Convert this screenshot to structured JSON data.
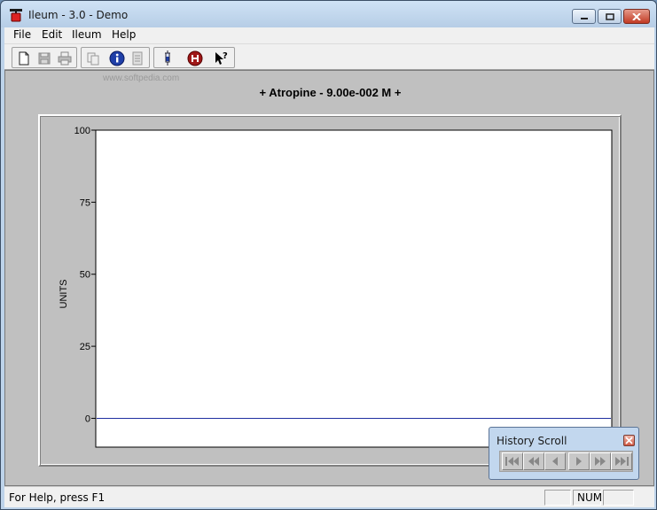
{
  "window": {
    "title": "Ileum - 3.0 - Demo",
    "icon": "ileum-app-icon",
    "controls": [
      "minimize",
      "maximize",
      "close"
    ]
  },
  "menu": [
    "File",
    "Edit",
    "Ileum",
    "Help"
  ],
  "toolbar": {
    "buttons": [
      {
        "name": "new-document-icon",
        "enabled": true
      },
      {
        "name": "save-icon",
        "enabled": false
      },
      {
        "name": "print-icon",
        "enabled": false
      },
      {
        "name": "copy-icon",
        "enabled": false
      },
      {
        "name": "info-icon",
        "enabled": true
      },
      {
        "name": "report-icon",
        "enabled": false
      },
      {
        "name": "syringe-icon",
        "enabled": true
      },
      {
        "name": "help-h-icon",
        "enabled": true
      },
      {
        "name": "context-help-icon",
        "enabled": true
      }
    ]
  },
  "watermark": "www.softpedia.com",
  "chart_data": {
    "type": "line",
    "title": "+ Atropine - 9.00e-002 M +",
    "ylabel": "UNITS",
    "xlabel": "",
    "ylim": [
      -10,
      100
    ],
    "yticks": [
      0,
      25,
      50,
      75,
      100
    ],
    "grid": false,
    "series": [
      {
        "color": "#1f2fa0",
        "x": [
          0,
          1
        ],
        "y": [
          0,
          0
        ]
      }
    ]
  },
  "history_scroll": {
    "title": "History Scroll",
    "buttons": [
      "first",
      "rewind",
      "back",
      "forward",
      "fast-forward",
      "last"
    ]
  },
  "status": {
    "help_text": "For Help, press F1",
    "panels": [
      "",
      "NUM",
      ""
    ]
  },
  "colors": {
    "window_frame": "#bdd3ea",
    "client_bg": "#c0c0c0",
    "plot_bg": "#ffffff",
    "series_line": "#1f2fa0"
  }
}
